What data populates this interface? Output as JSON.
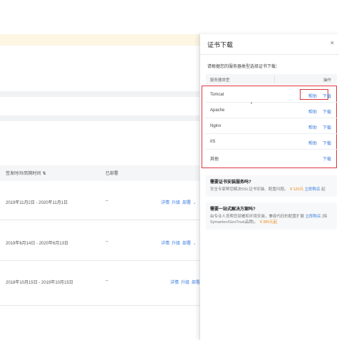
{
  "table": {
    "headers": {
      "issue_expiry": "签发时间/到期时间",
      "deployed": "已部署"
    },
    "rows": [
      {
        "dates": "2019年11月2日 - 2020年11月1日",
        "deployed": "--",
        "ops": [
          "详情",
          "升级",
          "部署"
        ]
      },
      {
        "dates": "2019年6月14日 - 2020年6月13日",
        "deployed": "--",
        "ops": [
          "详情",
          "升级",
          "部署"
        ]
      },
      {
        "dates": "2018年10月15日 - 2019年10月15日",
        "deployed": "--",
        "ops": [
          "详情",
          "升级",
          "部署"
        ]
      }
    ]
  },
  "panel": {
    "title": "证书下载",
    "close": "×",
    "hint": "请根据您的服务器类型选择证书下载：",
    "list_header": {
      "type": "服务器类型",
      "ops": "操作"
    },
    "servers": [
      {
        "name": "Tomcat",
        "help": "帮助",
        "download": "下载"
      },
      {
        "name": "Apache",
        "help": "帮助",
        "download": "下载"
      },
      {
        "name": "Nginx",
        "help": "帮助",
        "download": "下载"
      },
      {
        "name": "IIS",
        "help": "帮助",
        "download": "下载"
      },
      {
        "name": "其他",
        "help": "",
        "download": "下载"
      }
    ],
    "promo1": {
      "title": "需要证书安装服务吗?",
      "desc_a": "安全专家帮您解决SSL证书安装、配置问题。",
      "price": "￥120元",
      "link": "立即购买",
      "desc_b": "起"
    },
    "promo2": {
      "title": "需要一站式解决方案吗?",
      "desc_a": "由专业人员帮您部署和环境安装，兼容代码的配置扩展",
      "desc_b": "(除Symantec/GeoTrust品牌)。",
      "price": "￥380元起",
      "link": "立即购买"
    }
  },
  "colors": {
    "link": "#3b7ddd",
    "highlight": "#d9363e",
    "price": "#f08a24",
    "notice_band": "#fdf6e3"
  }
}
